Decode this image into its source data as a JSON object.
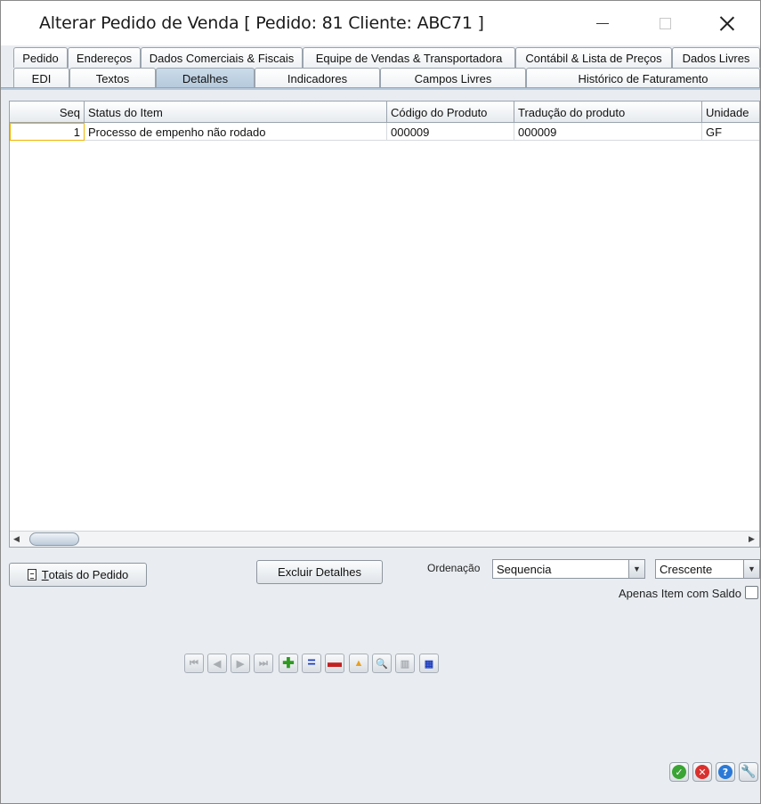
{
  "window": {
    "title": "Alterar Pedido de Venda [ Pedido: 81 Cliente: ABC71 ]"
  },
  "tabs_row1": [
    {
      "label": "Pedido"
    },
    {
      "label": "Endereços"
    },
    {
      "label": "Dados Comerciais & Fiscais"
    },
    {
      "label": "Equipe de Vendas & Transportadora"
    },
    {
      "label": "Contábil & Lista de Preços"
    },
    {
      "label": "Dados Livres"
    }
  ],
  "tabs_row2": [
    {
      "label": "EDI"
    },
    {
      "label": "Textos"
    },
    {
      "label": "Detalhes",
      "active": true
    },
    {
      "label": "Indicadores"
    },
    {
      "label": "Campos Livres"
    },
    {
      "label": "Histórico de Faturamento"
    }
  ],
  "grid": {
    "columns": [
      "Seq",
      "Status do Item",
      "Código do Produto",
      "Tradução do produto",
      "Unidade"
    ],
    "rows": [
      {
        "seq": "1",
        "status": "Processo de empenho não rodado",
        "codigo": "000009",
        "traducao": "000009",
        "unidade": "GF"
      }
    ]
  },
  "buttons": {
    "totais_prefix": "T",
    "totais_rest": "otais do Pedido",
    "excluir": "Excluir Detalhes"
  },
  "ordering": {
    "label": "Ordenação",
    "field_value": "Sequencia",
    "direction_value": "Crescente",
    "only_balance_label": "Apenas Item com Saldo"
  },
  "navigator": [
    "first-icon",
    "prev-icon",
    "next-icon",
    "last-icon",
    "add-icon",
    "edit-icon",
    "delete-icon",
    "confirm-icon",
    "search-icon",
    "grid-icon",
    "refresh-icon"
  ],
  "footer_buttons": [
    {
      "name": "ok",
      "glyph": "✓",
      "color": "#3aa535"
    },
    {
      "name": "cancel",
      "glyph": "✕",
      "color": "#d9302e"
    },
    {
      "name": "help",
      "glyph": "?",
      "color": "#2a79d8"
    },
    {
      "name": "tools",
      "glyph": "🔧",
      "color": "#e08a1e"
    }
  ]
}
